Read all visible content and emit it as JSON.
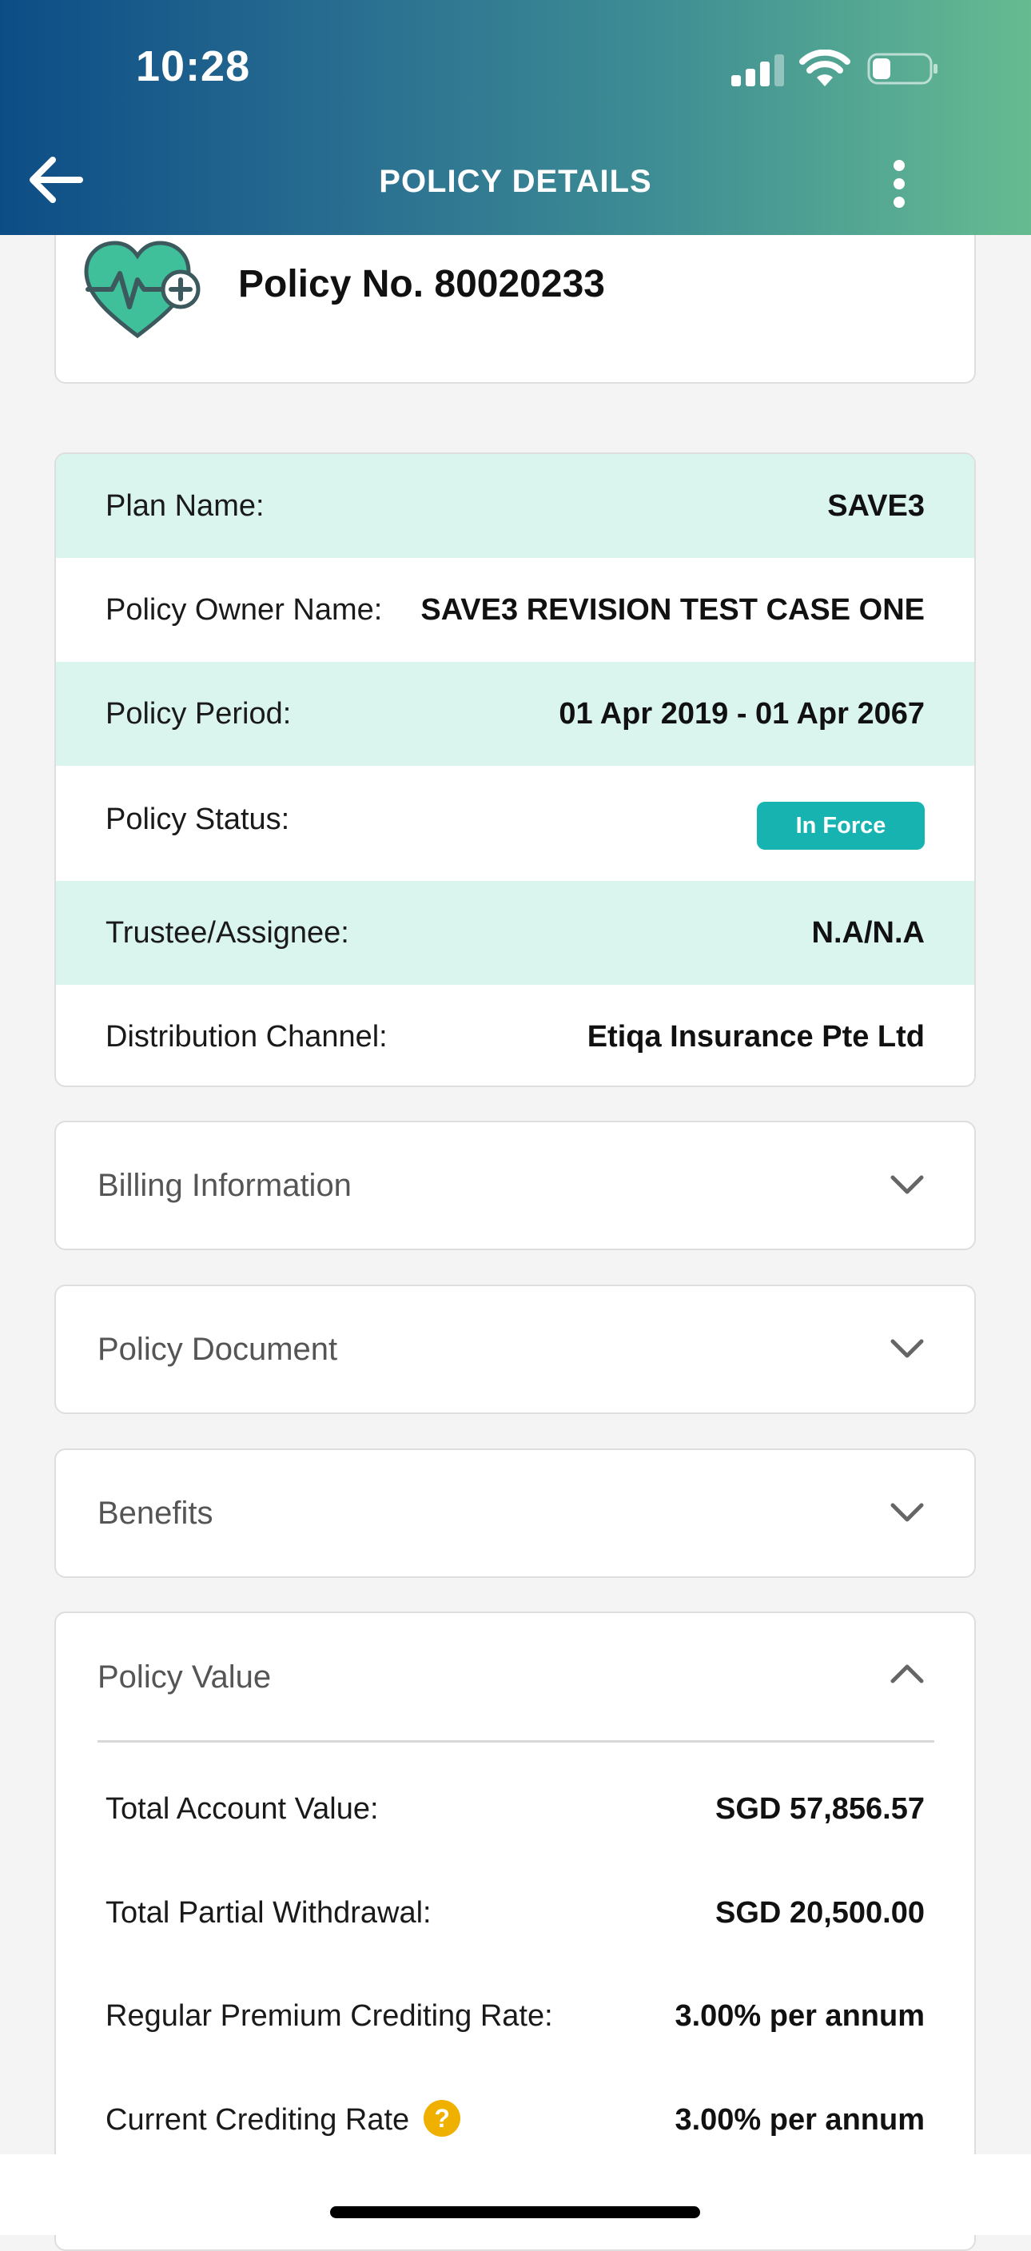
{
  "status_bar": {
    "time": "10:28"
  },
  "header": {
    "title": "POLICY DETAILS"
  },
  "policy": {
    "number_text": "Policy No. 80020233"
  },
  "details": [
    {
      "label": "Plan Name:",
      "value": "SAVE3"
    },
    {
      "label": "Policy Owner Name:",
      "value": "SAVE3 REVISION TEST CASE ONE"
    },
    {
      "label": "Policy Period:",
      "value": "01 Apr 2019 - 01 Apr 2067"
    },
    {
      "label": "Policy Status:",
      "value": "In Force"
    },
    {
      "label": "Trustee/Assignee:",
      "value": "N.A/N.A"
    },
    {
      "label": "Distribution Channel:",
      "value": "Etiqa Insurance Pte Ltd"
    }
  ],
  "sections": {
    "billing": "Billing Information",
    "document": "Policy Document",
    "benefits": "Benefits",
    "policy_value": "Policy Value"
  },
  "policy_value_rows": [
    {
      "label": "Total Account Value:",
      "value": "SGD 57,856.57"
    },
    {
      "label": "Total Partial Withdrawal:",
      "value": "SGD 20,500.00"
    },
    {
      "label": "Regular Premium Crediting Rate:",
      "value": "3.00% per annum"
    },
    {
      "label": "Current Crediting Rate",
      "value": "3.00% per annum"
    }
  ],
  "help_glyph": "?",
  "colors": {
    "header_gradient": [
      "#0d4d86",
      "#66bb91"
    ],
    "row_highlight": "#daf4ee",
    "status_badge": "#16b3b1",
    "help_icon": "#f0b000"
  }
}
